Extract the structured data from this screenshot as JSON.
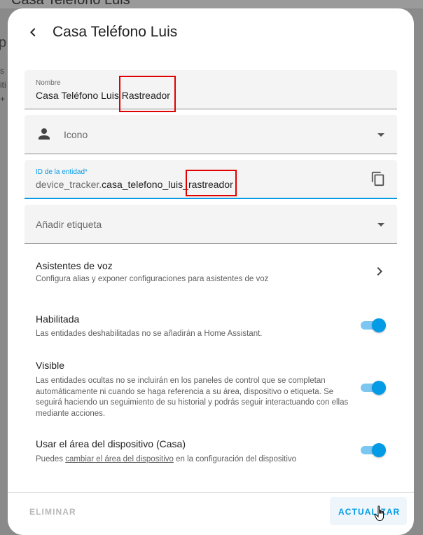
{
  "background": {
    "title": "Casa Teléfono Luis",
    "fragments": [
      "p",
      "s",
      "iti",
      "+ c"
    ]
  },
  "dialog": {
    "title": "Casa Teléfono Luis",
    "fields": {
      "name": {
        "label": "Nombre",
        "value_main": "Casa Teléfono Luis ",
        "value_highlight": "Rastreador"
      },
      "icon": {
        "placeholder": "Icono"
      },
      "entity_id": {
        "label": "ID de la entidad*",
        "prefix": "device_tracker.",
        "value_main": "casa_telefono_luis",
        "value_highlight": "_rastreador"
      },
      "tag": {
        "placeholder": "Añadir etiqueta"
      }
    },
    "voice": {
      "title": "Asistentes de voz",
      "description": "Configura alias y exponer configuraciones para asistentes de voz"
    },
    "enabled": {
      "title": "Habilitada",
      "description": "Las entidades deshabilitadas no se añadirán a Home Assistant.",
      "state": "on"
    },
    "visible": {
      "title": "Visible",
      "description": "Las entidades ocultas no se incluirán en los paneles de control que se completan automáticamente ni cuando se haga referencia a su área, dispositivo o etiqueta. Se seguirá haciendo un seguimiento de su historial y podrás seguir interactuando con ellas mediante acciones.",
      "state": "on"
    },
    "device_area": {
      "title": "Usar el área del dispositivo (Casa)",
      "desc_before": "Puedes ",
      "desc_link": "cambiar el área del dispositivo",
      "desc_after": " en la configuración del dispositivo",
      "state": "on"
    },
    "buttons": {
      "delete": "ELIMINAR",
      "update": "ACTUALIZAR"
    }
  },
  "colors": {
    "accent": "#039be5",
    "highlight_box": "#e00000"
  }
}
